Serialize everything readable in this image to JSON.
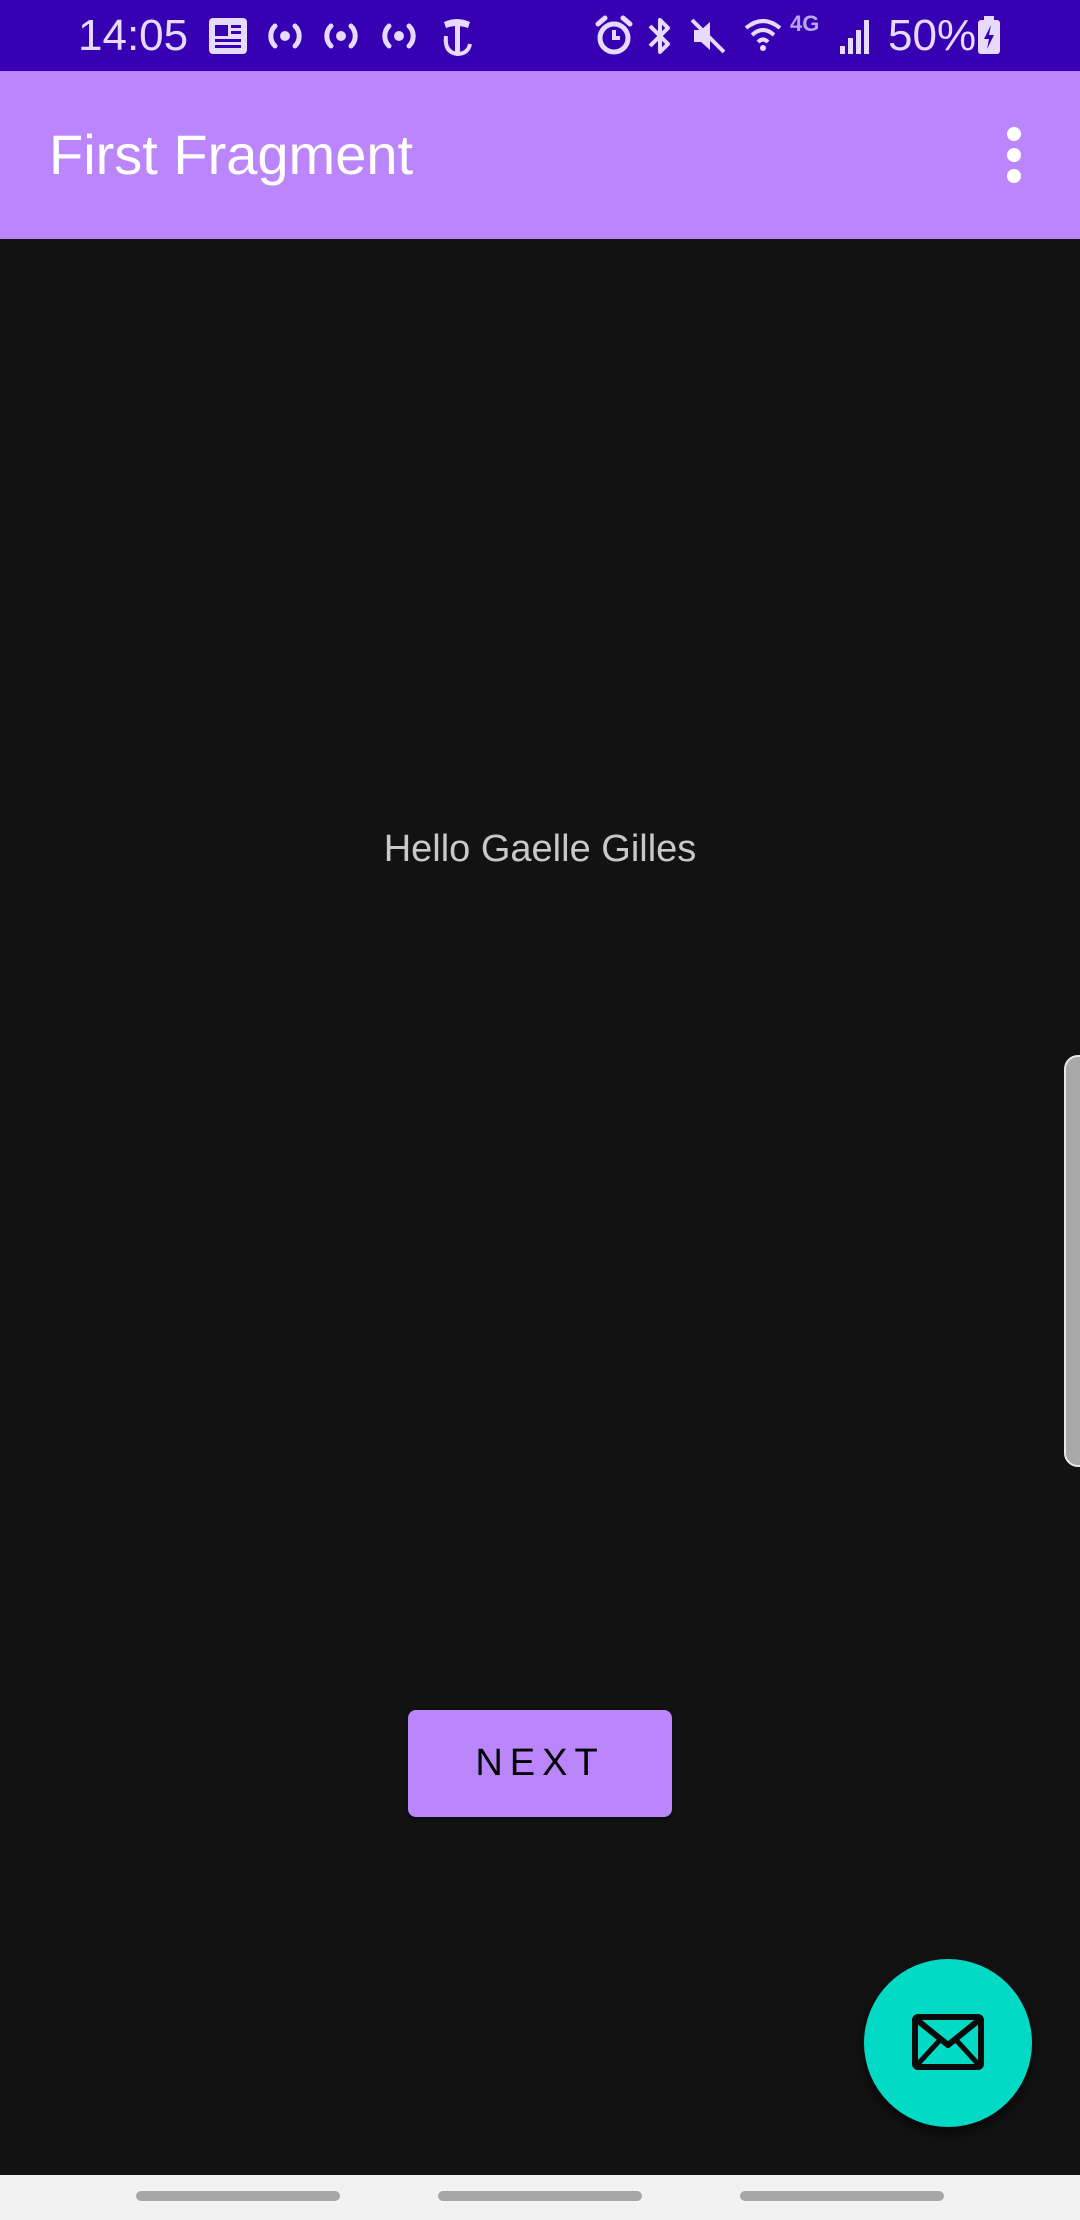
{
  "status_bar": {
    "time": "14:05",
    "battery_percent": "50%",
    "icons": [
      "news-icon",
      "broadcast-icon",
      "broadcast-icon",
      "broadcast-icon",
      "nyt-icon",
      "alarm-icon",
      "bluetooth-icon",
      "mute-icon",
      "wifi-icon",
      "4g-network-icon",
      "signal-icon",
      "battery-charging-icon"
    ],
    "network_label": "4G",
    "color": "#3700B3"
  },
  "app_bar": {
    "title": "First Fragment",
    "menu_icon": "more-vert-icon",
    "color": "#BB86FC"
  },
  "main": {
    "greeting": "Hello Gaelle Gilles",
    "next_button_label": "NEXT",
    "background": "#121212"
  },
  "fab": {
    "icon": "email-icon",
    "color": "#03DAC5"
  },
  "nav_bar": {
    "color": "#F2F2F2"
  }
}
